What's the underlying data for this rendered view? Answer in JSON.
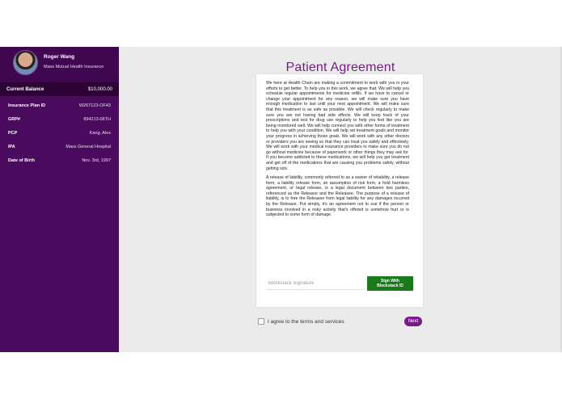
{
  "sidebar": {
    "profile": {
      "name": "Roger Wang",
      "insurer": "Mass Mutual Health Insurance"
    },
    "balance": {
      "label": "Current Balance",
      "value": "$10,000.00"
    },
    "info": [
      {
        "label": "Insurance Plan ID",
        "value": "W267123-OF43"
      },
      {
        "label": "GRP#",
        "value": "894213-06TH"
      },
      {
        "label": "PCP",
        "value": "Kang, Alex"
      },
      {
        "label": "IPA",
        "value": "Mass General Hospital"
      },
      {
        "label": "Date of Birth",
        "value": "Nov. 3rd, 1997"
      }
    ]
  },
  "main": {
    "title": "Patient Agreement",
    "agreement": {
      "paragraph1": "We here at Health Chain are making a commitment to work with you in your efforts to get better. To help you in this work, we agree that: We will help you schedule regular appointments for medicine refills. If we have to cancel or change your appointment for any reason, we will make sure you have enough medication to last until your next appointment. We will make sure that this treatment is as safe as possible. We will check regularly to make sure you are not having bad side effects. We will keep track of your prescriptions and test for drug use regularly to help you feel like you are being monitored well. We will help connect you with other forms of treatment to help you with your condition. We will help set treatment goals and monitor your progress in achieving those goals. We will work with any other doctors or providers you are seeing so that they can treat you safely and effectively. We will work with your medical insurance providers to make sure you do not go without medicine because of paperwork or other things they may ask for. If you become addicted to these medications, we will help you get treatment and get off of the medications that are causing you problems safely, without getting sick.",
      "paragraph2": "A release of liability, commonly referred to as a waiver of reliability, a release form, a liability release form, an assumption of risk form, a hold harmless agreement, or legal release, is a legal document between two parties, referenced as the Releasor and the Releasee. The purpose of a release of liability, is to free the Releasee from legal liability for any damages incurred by the Releasor. Put simply, it's an agreement not to sue if the person or business involved in a risky activity that's offered is somehow hurt or is subjected to some form of damage."
    },
    "signature": {
      "placeholder": "Blockstack Signature",
      "value": "",
      "button_label": "Sign With Blockstack ID"
    },
    "agree_label": "I agree to the terms and services",
    "next_label": "Next"
  },
  "colors": {
    "sidebar_bg": "#4a0a5e",
    "balance_bg": "#2d0336",
    "accent": "#7a1a8a",
    "sign_button": "#1a7a1a",
    "main_bg": "#ebebeb"
  }
}
